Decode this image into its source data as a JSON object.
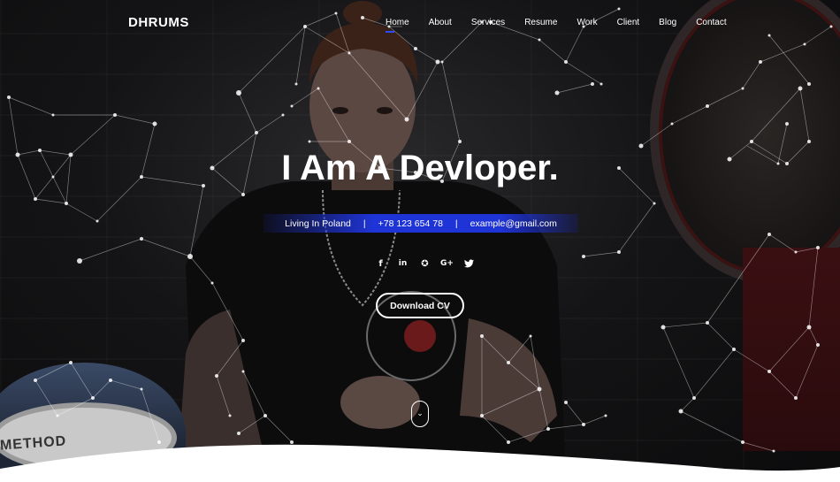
{
  "brand": {
    "logo": "DHRUMS"
  },
  "nav": {
    "items": [
      {
        "label": "Home",
        "active": true
      },
      {
        "label": "About"
      },
      {
        "label": "Services"
      },
      {
        "label": "Resume"
      },
      {
        "label": "Work"
      },
      {
        "label": "Client"
      },
      {
        "label": "Blog"
      },
      {
        "label": "Contact"
      }
    ],
    "accent_color": "#2b4bff"
  },
  "hero": {
    "headline_light": "I Am",
    "headline_bold": "A Devloper.",
    "info": {
      "location": "Living In Poland",
      "separator": "|",
      "phone": "+78 123 654 78",
      "email": "example@gmail.com"
    },
    "social_icons": [
      "facebook-icon",
      "linkedin-icon",
      "dribbble-icon",
      "google-plus-icon",
      "twitter-icon"
    ],
    "social_glyphs": [
      "f",
      "in",
      "✪",
      "G+",
      "🐦"
    ],
    "cv_button": "Download CV",
    "drum_text": "METHOD",
    "scroll_glyph": "⌄"
  }
}
